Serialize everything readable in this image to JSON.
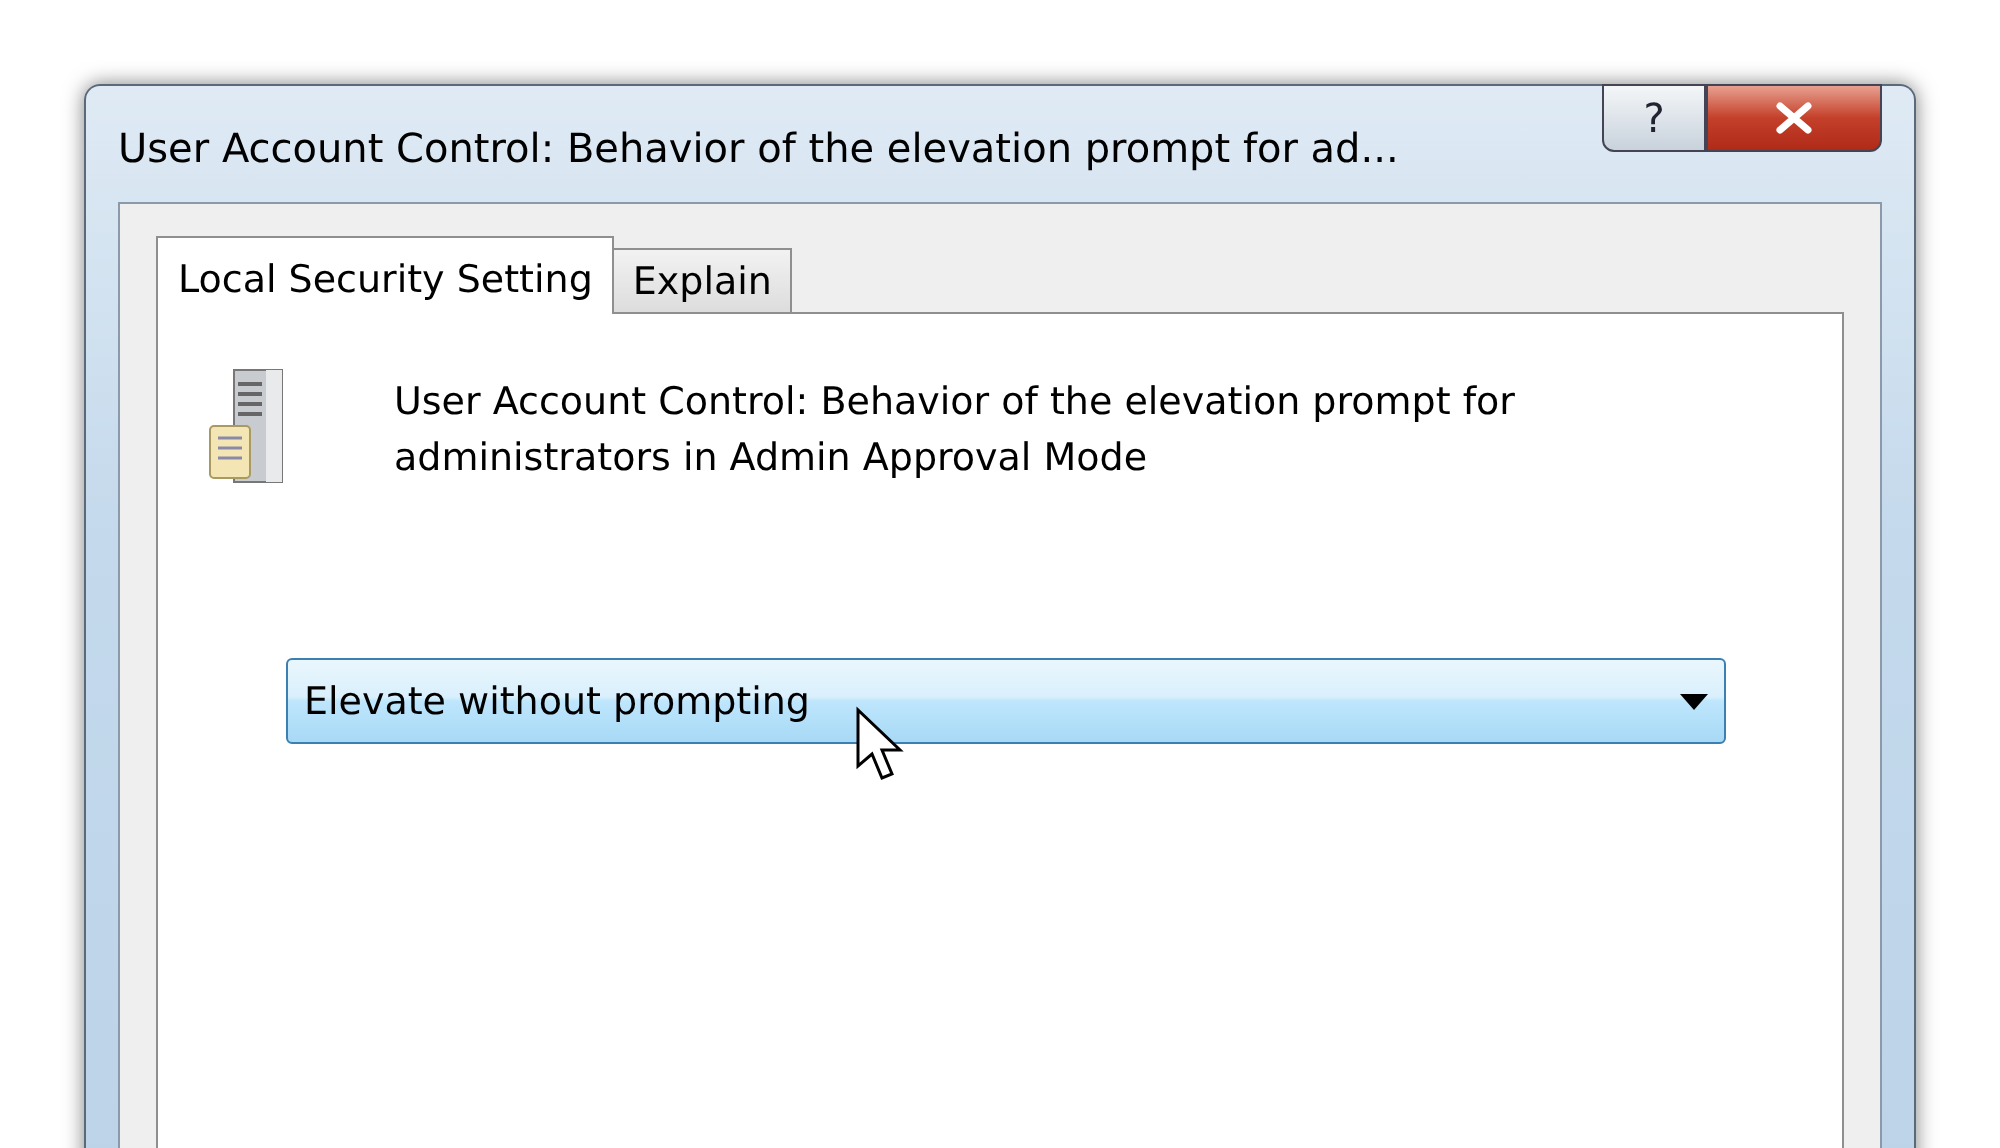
{
  "window": {
    "title": "User Account Control: Behavior of the elevation prompt for ad...",
    "help_button": "?"
  },
  "tabs": [
    {
      "label": "Local Security Setting",
      "selected": true
    },
    {
      "label": "Explain",
      "selected": false
    }
  ],
  "policy": {
    "description": "User Account Control: Behavior of the elevation prompt for administrators in Admin Approval Mode"
  },
  "dropdown": {
    "value": "Elevate without prompting"
  }
}
